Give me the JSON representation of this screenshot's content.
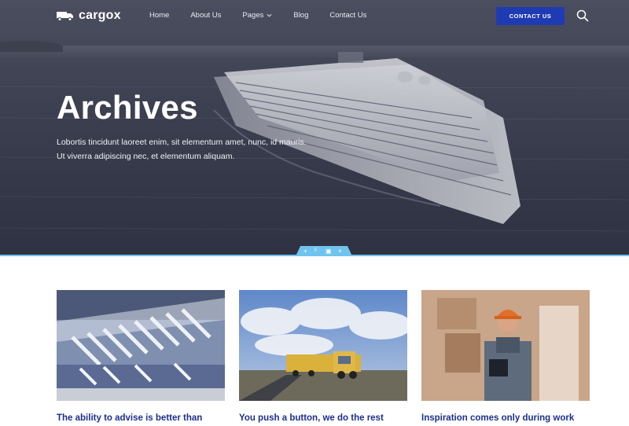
{
  "brand": {
    "name": "cargox"
  },
  "nav": {
    "items": [
      {
        "label": "Home"
      },
      {
        "label": "About Us"
      },
      {
        "label": "Pages"
      },
      {
        "label": "Blog"
      },
      {
        "label": "Contact Us"
      }
    ],
    "cta_label": "CONTACT US"
  },
  "hero": {
    "title": "Archives",
    "description_line1": "Lobortis tincidunt laoreet enim, sit elementum amet, nunc, id mauris.",
    "description_line2": "Ut viverra adipiscing nec, et elementum aliquam."
  },
  "posts": [
    {
      "title": "The ability to advise is better than"
    },
    {
      "title": "You push a button, we do the rest"
    },
    {
      "title": "Inspiration comes only during work"
    }
  ],
  "colors": {
    "accent": "#1f3bb3",
    "title_blue": "#1c2f8e",
    "editor_blue": "#6fc3ef"
  }
}
